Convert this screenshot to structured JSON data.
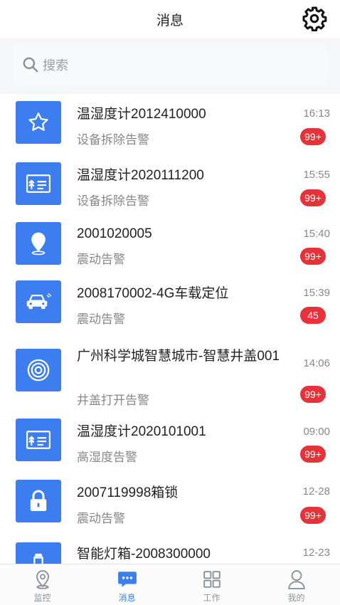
{
  "header": {
    "title": "消息",
    "settings_icon": "gear-icon"
  },
  "search": {
    "placeholder": "搜索",
    "icon": "search-icon"
  },
  "colors": {
    "accent": "#3c7df0",
    "badge": "#e6323a",
    "muted": "#888888"
  },
  "messages": [
    {
      "name": "温湿度计2012410000",
      "subtitle": "设备拆除告警",
      "time": "16:13",
      "badge": "99+",
      "icon": "star-icon"
    },
    {
      "name": "温湿度计2020111200",
      "subtitle": "设备拆除告警",
      "time": "15:55",
      "badge": "99+",
      "icon": "sensor-card-icon"
    },
    {
      "name": "2001020005",
      "subtitle": "震动告警",
      "time": "15:40",
      "badge": "99+",
      "icon": "location-pin-icon"
    },
    {
      "name": "2008170002-4G车载定位",
      "subtitle": "震动告警",
      "time": "15:39",
      "badge": "45",
      "icon": "car-icon"
    },
    {
      "name": "广州科学城智慧城市-智慧井盖001",
      "subtitle": "井盖打开告警",
      "time": "14:06",
      "badge": "99+",
      "icon": "manhole-cover-icon"
    },
    {
      "name": "温湿度计2020101001",
      "subtitle": "高湿度告警",
      "time": "09:00",
      "badge": "99+",
      "icon": "sensor-card-icon"
    },
    {
      "name": "2007119998箱锁",
      "subtitle": "震动告警",
      "time": "12-28",
      "badge": "99+",
      "icon": "lock-icon"
    },
    {
      "name": "智能灯箱-2008300000",
      "subtitle": "",
      "time": "12-23",
      "badge": "",
      "icon": "lamp-icon"
    }
  ],
  "tabs": [
    {
      "label": "监控",
      "icon": "location-pin-icon",
      "active": false
    },
    {
      "label": "消息",
      "icon": "chat-icon",
      "active": true
    },
    {
      "label": "工作",
      "icon": "grid-icon",
      "active": false
    },
    {
      "label": "我的",
      "icon": "user-icon",
      "active": false
    }
  ]
}
